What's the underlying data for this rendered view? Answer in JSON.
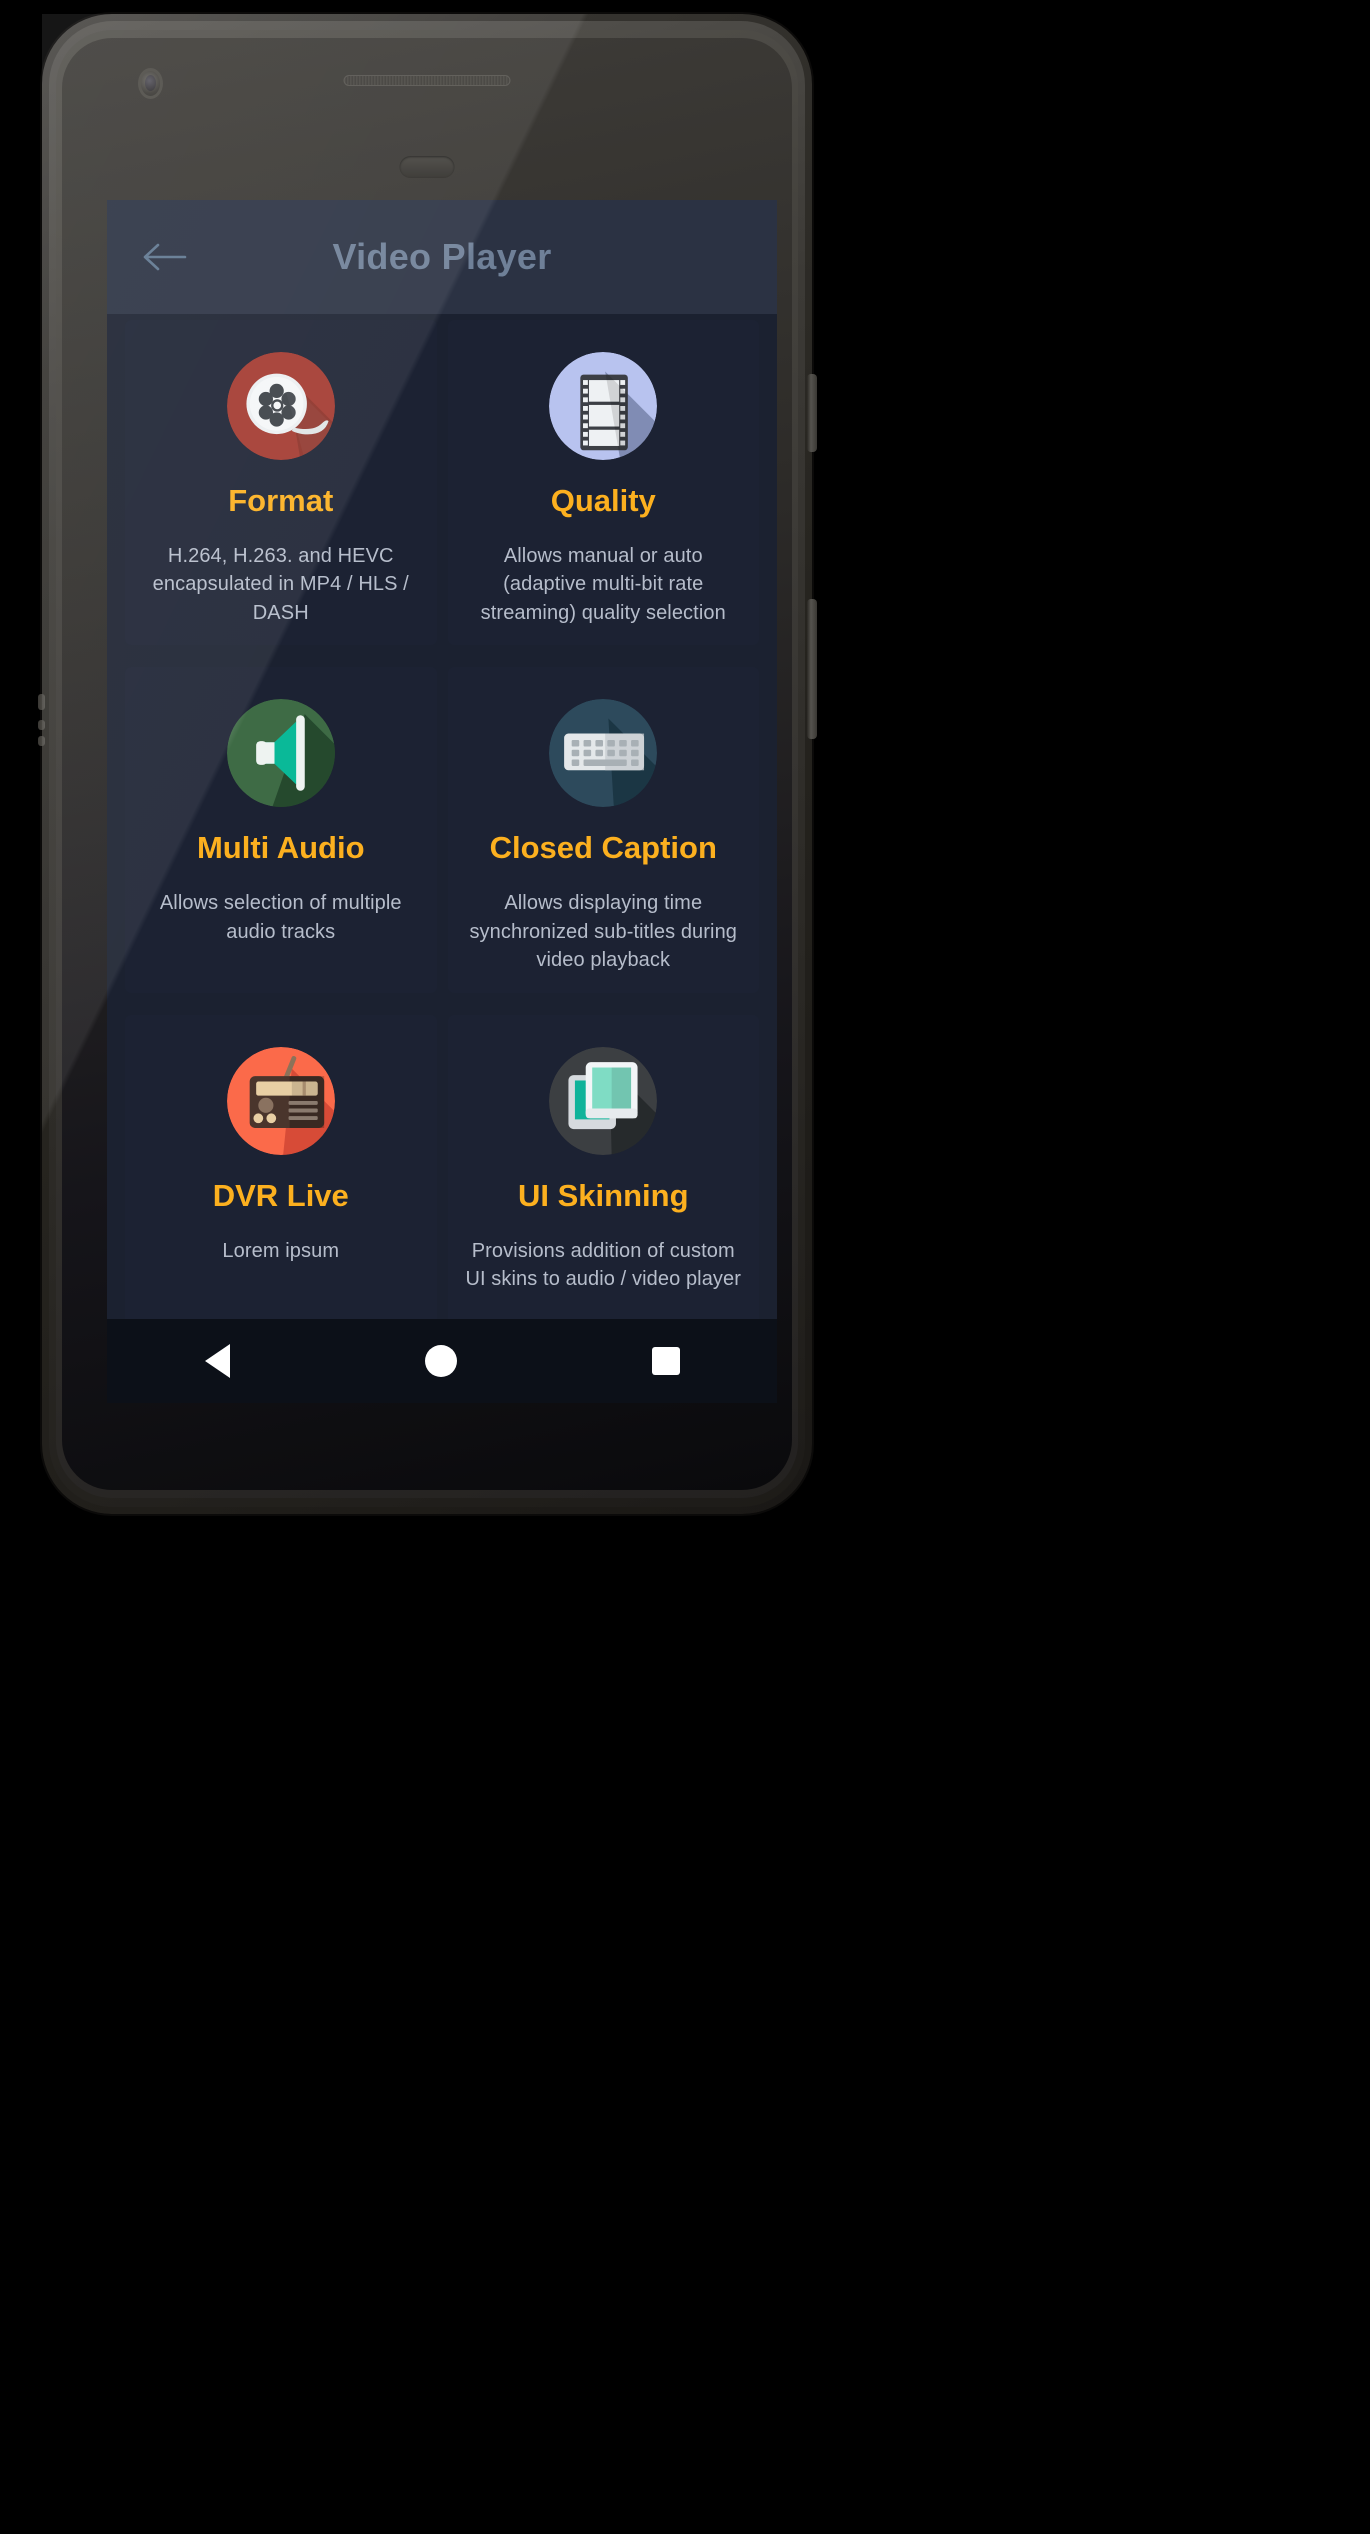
{
  "device": {
    "camera_icon": "front-camera",
    "speaker_icon": "earpiece-speaker",
    "home_pill_icon": "home-indicator"
  },
  "appbar": {
    "back_icon": "back-arrow-icon",
    "title": "Video Player"
  },
  "colors": {
    "accent": "#fcb01f",
    "appbar_bg": "#2b3243",
    "screen_bg": "#1b2130",
    "card_bg": "#1c2233",
    "title_text": "#6f8098",
    "desc_text": "#b6bdcb",
    "navbar_bg": "#0c1018"
  },
  "cards": [
    {
      "title": "Format",
      "desc": "H.264, H.263. and HEVC encapsulated in MP4 / HLS / DASH",
      "icon": "film-reel-icon",
      "icon_bg": "#a3392f",
      "icon_fg": "#eceff1"
    },
    {
      "title": "Quality",
      "desc": "Allows manual or auto (adaptive multi-bit rate streaming) quality selection",
      "icon": "film-strip-icon",
      "icon_bg": "#b8c3ef",
      "icon_fg": "#3c3f45"
    },
    {
      "title": "Multi Audio",
      "desc": "Allows selection of multiple audio tracks",
      "icon": "speaker-volume-icon",
      "icon_bg": "#3e6b45",
      "icon_fg": "#12b persons"
    },
    {
      "title": "Closed Caption",
      "desc": "Allows displaying time synchronized sub-titles during video playback",
      "icon": "keyboard-icon",
      "icon_bg": "#2d4a5c",
      "icon_fg": "#e4e8ea"
    },
    {
      "title": "DVR Live",
      "desc": "Lorem ipsum",
      "icon": "radio-icon",
      "icon_bg": "#fb6a4a",
      "icon_fg": "#4a352c"
    },
    {
      "title": "UI Skinning",
      "desc": "Provisions addition of custom UI skins to audio / video player",
      "icon": "skins-frames-icon",
      "icon_bg": "#3c3f42",
      "icon_fg": "#6fd6bd"
    }
  ],
  "navbar": {
    "back_label": "back-triangle",
    "home_label": "home-circle",
    "recents_label": "recents-square"
  }
}
